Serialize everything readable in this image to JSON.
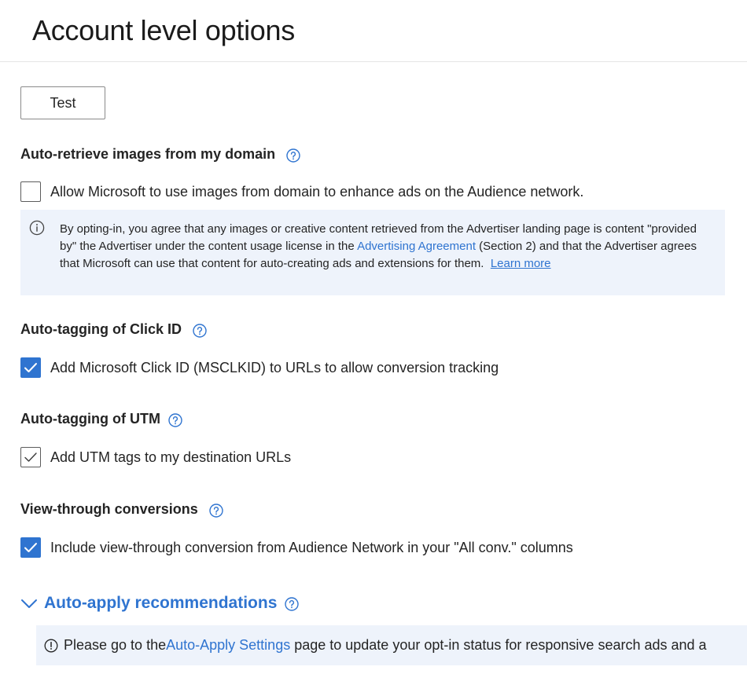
{
  "header": {
    "title": "Account level options"
  },
  "test_button": {
    "label": "Test"
  },
  "sections": {
    "images": {
      "title": "Auto-retrieve images from my domain",
      "checkbox_label": "Allow Microsoft to use images from domain to enhance ads on the Audience network.",
      "checked": false,
      "info": {
        "text_before_link": "By opting-in, you agree that any images or creative content retrieved from the Advertiser landing page is content \"provided by\" the Advertiser under the content usage license in the ",
        "link": "Advertising Agreement",
        "text_after_link": " (Section 2) and that the Advertiser agrees that Microsoft can use that content for auto-creating ads and extensions for them.",
        "learn_more": "Learn more"
      }
    },
    "click_id": {
      "title": "Auto-tagging of Click ID",
      "checkbox_label": "Add Microsoft Click ID (MSCLKID) to URLs to allow conversion tracking",
      "checked": true
    },
    "utm": {
      "title": "Auto-tagging of UTM",
      "checkbox_label": "Add UTM tags to my destination URLs",
      "checked": true
    },
    "view_through": {
      "title": "View-through conversions",
      "checkbox_label": "Include view-through conversion from Audience Network in your \"All conv.\" columns",
      "checked": true
    }
  },
  "auto_apply": {
    "title": "Auto-apply recommendations",
    "notice_before_link": "Please go to the ",
    "notice_link": "Auto-Apply Settings",
    "notice_after_link": " page to update your opt-in status for responsive search ads and a"
  },
  "colors": {
    "accent": "#2f74d0",
    "info_bg": "#eef3fb",
    "text": "#242424"
  },
  "icons": [
    "help-circle-icon",
    "info-circle-icon",
    "checkmark-icon",
    "chevron-down-icon",
    "alert-circle-icon"
  ]
}
